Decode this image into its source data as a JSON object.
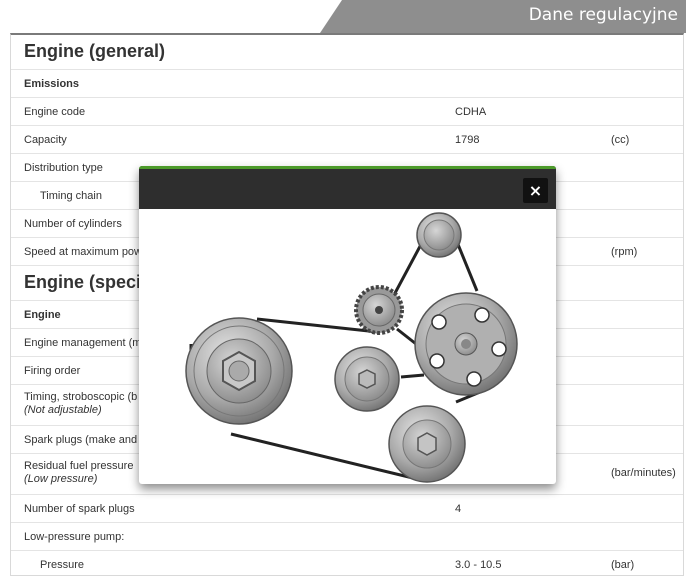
{
  "banner": {
    "title": "Dane regulacyjne"
  },
  "sections": {
    "engine_general": "Engine (general)",
    "engine_specific": "Engine (specif"
  },
  "rows": {
    "emissions": "Emissions",
    "engine_code": {
      "label": "Engine code",
      "value": "CDHA"
    },
    "capacity": {
      "label": "Capacity",
      "value": "1798",
      "unit": "(cc)"
    },
    "distribution_type": "Distribution type",
    "timing_chain": "Timing chain",
    "cylinders": "Number of cylinders",
    "speed_max_power": {
      "label": "Speed at maximum pow",
      "unit": "(rpm)"
    },
    "engine": "Engine",
    "engine_management": "Engine management (m",
    "firing_order": "Firing order",
    "timing_strobo": {
      "label": "Timing, stroboscopic (b",
      "note": "(Not adjustable)"
    },
    "spark_plugs_make": "Spark plugs (make and",
    "residual_pressure": {
      "label": "Residual fuel pressure",
      "note": "(Low pressure)",
      "unit": "(bar/minutes)"
    },
    "spark_plug_count": {
      "label": "Number of spark plugs",
      "value": "4"
    },
    "low_pressure_pump": "Low-pressure pump:",
    "pressure": {
      "label": "Pressure",
      "value": "3.0 - 10.5",
      "unit": "(bar)"
    }
  },
  "modal": {
    "close_label": "×",
    "accent_color": "#4c9a2a",
    "header_color": "#2e2e2e"
  }
}
